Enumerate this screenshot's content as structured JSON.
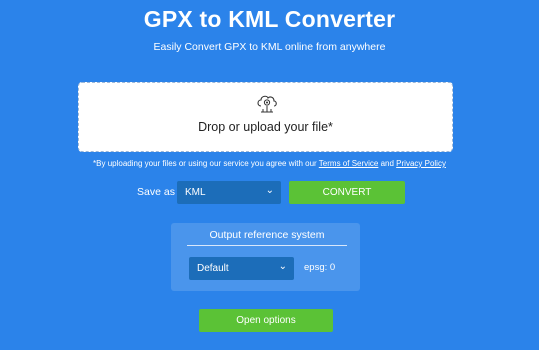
{
  "header": {
    "title": "GPX to KML Converter",
    "subtitle": "Easily Convert GPX to KML online from anywhere"
  },
  "upload": {
    "icon": "cloud-upload-gear-icon",
    "text": "Drop or upload your file*"
  },
  "consent": {
    "prefix": "*By uploading your files or using our service you agree with our ",
    "terms": "Terms of Service",
    "and": " and ",
    "privacy": "Privacy Policy"
  },
  "conversion": {
    "save_as_label": "Save as",
    "format": "KML",
    "convert_label": "CONVERT"
  },
  "reference": {
    "title": "Output reference system",
    "selected": "Default",
    "epsg": "epsg: 0"
  },
  "options": {
    "label": "Open options"
  },
  "colors": {
    "background": "#2b83ea",
    "button_green": "#5bc236",
    "select_blue": "#1c6db9"
  }
}
